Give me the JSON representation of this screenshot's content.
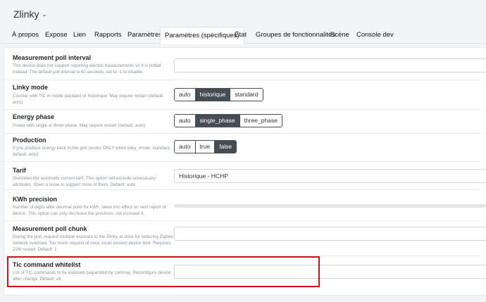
{
  "header": {
    "device_name": "Zlinky",
    "caret": "⌄"
  },
  "tabs": [
    {
      "label": "À propos"
    },
    {
      "label": "Expose"
    },
    {
      "label": "Lien"
    },
    {
      "label": "Rapports"
    },
    {
      "label": "Paramètres"
    },
    {
      "label": "Paramètres (spécifiques)",
      "active": true
    },
    {
      "label": "État"
    },
    {
      "label": "Groupes de fonctionnalités"
    },
    {
      "label": "Scène"
    },
    {
      "label": "Console dev"
    }
  ],
  "settings": {
    "poll_interval": {
      "title": "Measurement poll interval",
      "desc": "This device does not support reporting electric measurements so it is polled instead. The default poll interval is 60 seconds, set to -1 to disable.",
      "value": ""
    },
    "linky_mode": {
      "title": "Linky mode",
      "desc": "Counter with TIC in mode standard or historique. May require restart (default: auto)",
      "options": [
        "auto",
        "historique",
        "standard"
      ],
      "selected": "historique"
    },
    "energy_phase": {
      "title": "Energy phase",
      "desc": "Power with single or three phase. May require restart (default: auto)",
      "options": [
        "auto",
        "single_phase",
        "three_phase"
      ],
      "selected": "single_phase"
    },
    "production": {
      "title": "Production",
      "desc": "If you produce energy back to the grid (works ONLY when linky_mode: standard, default: auto)",
      "options": [
        "auto",
        "true",
        "false"
      ],
      "selected": "false"
    },
    "tarif": {
      "title": "Tarif",
      "desc": "Overrides the automatic current tarif. This option will exclude unnecesary attributes. Open a issue to support more of them. Default: auto",
      "value": "Historique - HCHP"
    },
    "kwh_precision": {
      "title": "KWh precision",
      "desc": "Number of digits after decimal point for kWh, takes into effect on next report of device. This option can only decrease the precision, not increase it."
    },
    "poll_chunk": {
      "title": "Measurement poll chunk",
      "desc": "During the poll, request multiple exposes to the Zlinky at once for reducing Zigbee network overload. Too much request at once could exceed device limit. Requires Z2M restart. Default: 1",
      "value": ""
    },
    "tic_whitelist": {
      "title": "Tic command whitelist",
      "desc": "List of TIC commands to be exposed (separated by comma). Reconfigure device after change. Default: all",
      "value": ""
    }
  },
  "colors": {
    "highlight": "#d0121b",
    "selected_button": "#454c53"
  }
}
